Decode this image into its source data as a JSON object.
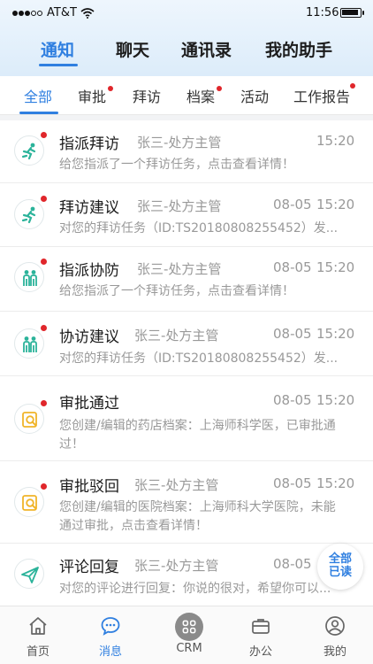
{
  "status_bar": {
    "carrier": "AT&T",
    "time": "11:56"
  },
  "top_tabs": [
    {
      "label": "通知",
      "active": true
    },
    {
      "label": "聊天",
      "active": false
    },
    {
      "label": "通讯录",
      "active": false
    },
    {
      "label": "我的助手",
      "active": false
    }
  ],
  "sub_tabs": [
    {
      "label": "全部",
      "active": true,
      "badge": false
    },
    {
      "label": "审批",
      "active": false,
      "badge": true
    },
    {
      "label": "拜访",
      "active": false,
      "badge": false
    },
    {
      "label": "档案",
      "active": false,
      "badge": true
    },
    {
      "label": "活动",
      "active": false,
      "badge": false
    },
    {
      "label": "工作报告",
      "active": false,
      "badge": true
    }
  ],
  "notifications": [
    {
      "icon": "run-icon",
      "title": "指派拜访",
      "sender": "张三-处方主管",
      "date": "",
      "time": "15:20",
      "desc": "给您指派了一个拜访任务，点击查看详情！",
      "unread": true
    },
    {
      "icon": "run-icon",
      "title": "拜访建议",
      "sender": "张三-处方主管",
      "date": "08-05",
      "time": "15:20",
      "desc": "对您的拜访任务（ID:TS20180808255452）发...",
      "unread": true
    },
    {
      "icon": "people-icon",
      "title": "指派协防",
      "sender": "张三-处方主管",
      "date": "08-05",
      "time": "15:20",
      "desc": "给您指派了一个拜访任务，点击查看详情！",
      "unread": true
    },
    {
      "icon": "people-icon",
      "title": "协访建议",
      "sender": "张三-处方主管",
      "date": "08-05",
      "time": "15:20",
      "desc": "对您的拜访任务（ID:TS20180808255452）发...",
      "unread": true
    },
    {
      "icon": "approve-search-icon",
      "title": "审批通过",
      "sender": "",
      "date": "08-05",
      "time": "15:20",
      "desc": "您创建/编辑的药店档案：上海师科学医，已审批通过！",
      "unread": true
    },
    {
      "icon": "approve-search-icon",
      "title": "审批驳回",
      "sender": "张三-处方主管",
      "date": "08-05",
      "time": "15:20",
      "desc": "您创建/编辑的医院档案：上海师科大学医院，未能通过审批，点击查看详情！",
      "unread": true
    },
    {
      "icon": "paper-plane-icon",
      "title": "评论回复",
      "sender": "张三-处方主管",
      "date": "08-05",
      "time": "",
      "desc": "对您的评论进行回复：你说的很对，希望你可以...",
      "unread": false
    }
  ],
  "read_all": {
    "line1": "全部",
    "line2": "已读"
  },
  "bottom_nav": [
    {
      "label": "首页",
      "icon": "home-icon",
      "active": false
    },
    {
      "label": "消息",
      "icon": "chat-icon",
      "active": true
    },
    {
      "label": "CRM",
      "icon": "crm-icon",
      "active": false
    },
    {
      "label": "办公",
      "icon": "briefcase-icon",
      "active": false
    },
    {
      "label": "我的",
      "icon": "user-icon",
      "active": false
    }
  ],
  "colors": {
    "accent": "#2f7fe0",
    "badge": "#e0262b",
    "icon_green": "#2bb39a",
    "icon_yellow": "#f0b429"
  }
}
